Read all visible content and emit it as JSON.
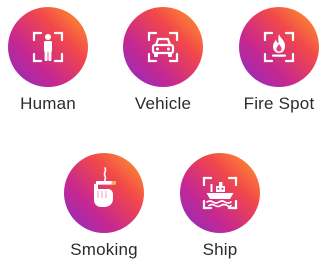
{
  "detection_types": [
    {
      "label": "Human",
      "icon": "human-icon"
    },
    {
      "label": "Vehicle",
      "icon": "vehicle-icon"
    },
    {
      "label": "Fire Spot",
      "icon": "fire-icon"
    },
    {
      "label": "Smoking",
      "icon": "smoking-hand-icon"
    },
    {
      "label": "Ship",
      "icon": "ship-icon"
    }
  ],
  "colors": {
    "gradient_orange": "#ffa12a",
    "gradient_red": "#f2484a",
    "gradient_magenta": "#c7288f",
    "gradient_purple": "#8a2cc5",
    "label_text": "#2b2b2b"
  }
}
